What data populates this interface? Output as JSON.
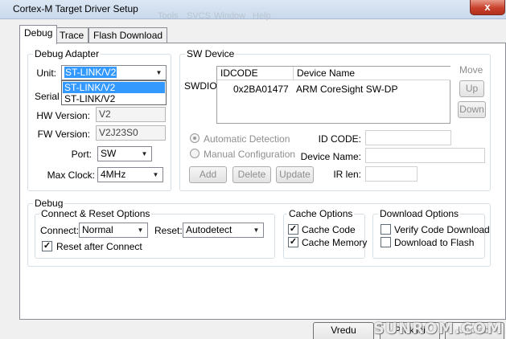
{
  "window": {
    "title": "Cortex-M Target Driver Setup",
    "close_glyph": "x"
  },
  "background_menu": [
    "Tools",
    "SVCS",
    "Window",
    "Help"
  ],
  "tabs": [
    {
      "label": "Debug",
      "active": true
    },
    {
      "label": "Trace",
      "active": false
    },
    {
      "label": "Flash Download",
      "active": false
    }
  ],
  "debug_adapter": {
    "legend": "Debug Adapter",
    "unit_label": "Unit:",
    "unit_value": "ST-LINK/V2",
    "unit_options": [
      "ST-LINK/V2",
      "ST-LINK/V2"
    ],
    "serial_label": "Serial N",
    "hw_label": "HW Version:",
    "hw_value": "V2",
    "fw_label": "FW Version:",
    "fw_value": "V2J23S0",
    "port_label": "Port:",
    "port_value": "SW",
    "clock_label": "Max Clock:",
    "clock_value": "4MHz"
  },
  "sw_device": {
    "legend": "SW Device",
    "row_label": "SWDIO",
    "columns": [
      "IDCODE",
      "Device Name"
    ],
    "rows": [
      {
        "idcode": "0x2BA01477",
        "device_name": "ARM CoreSight SW-DP"
      }
    ],
    "move_label": "Move",
    "up_label": "Up",
    "down_label": "Down",
    "auto_detect_label": "Automatic Detection",
    "manual_config_label": "Manual Configuration",
    "id_code_label": "ID CODE:",
    "device_name_label": "Device Name:",
    "ir_len_label": "IR len:",
    "add_label": "Add",
    "delete_label": "Delete",
    "update_label": "Update"
  },
  "debug": {
    "legend": "Debug",
    "connect_reset": {
      "legend": "Connect & Reset Options",
      "connect_label": "Connect:",
      "connect_value": "Normal",
      "reset_label": "Reset:",
      "reset_value": "Autodetect",
      "reset_after_connect_label": "Reset after Connect",
      "reset_after_connect_checked": true
    },
    "cache": {
      "legend": "Cache Options",
      "cache_code_label": "Cache Code",
      "cache_code_checked": true,
      "cache_memory_label": "Cache Memory",
      "cache_memory_checked": true
    },
    "download": {
      "legend": "Download Options",
      "verify_label": "Verify Code Download",
      "verify_checked": false,
      "download_flash_label": "Download to Flash",
      "download_flash_checked": false
    }
  },
  "footer": {
    "ok_label": "Vredu",
    "cancel_label": "Prekliči",
    "apply_label": "Uporabi"
  },
  "watermark": "SUNROM.COM",
  "check_glyph": "✓",
  "dropdown_glyph": "▼"
}
